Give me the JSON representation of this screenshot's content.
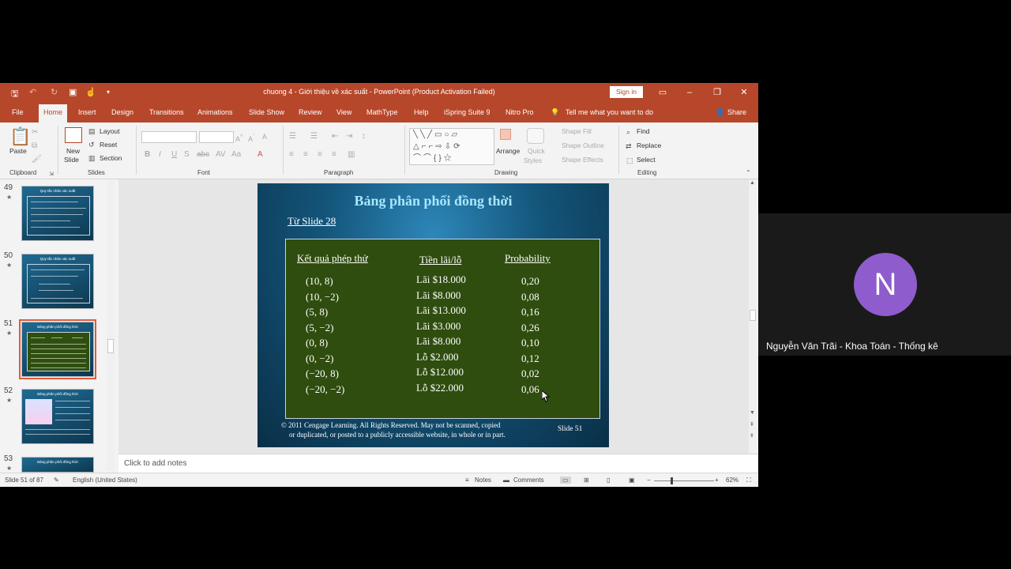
{
  "window": {
    "title": "chuong 4 - Giới thiệu về xác suất  -  PowerPoint (Product Activation Failed)",
    "sign_in": "Sign in",
    "share": "Share",
    "tell_me": "Tell me what you want to do"
  },
  "tabs": [
    "File",
    "Home",
    "Insert",
    "Design",
    "Transitions",
    "Animations",
    "Slide Show",
    "Review",
    "View",
    "MathType",
    "Help",
    "iSpring Suite 9",
    "Nitro Pro"
  ],
  "ribbon": {
    "paste": "Paste",
    "new_slide_1": "New",
    "new_slide_2": "Slide",
    "layout": "Layout",
    "reset": "Reset",
    "section": "Section",
    "arrange": "Arrange",
    "quick_styles_1": "Quick",
    "quick_styles_2": "Styles",
    "shape_fill": "Shape Fill",
    "shape_outline": "Shape Outline",
    "shape_effects": "Shape Effects",
    "find": "Find",
    "replace": "Replace",
    "select": "Select",
    "groups": [
      "Clipboard",
      "Slides",
      "Font",
      "Paragraph",
      "Drawing",
      "Editing"
    ]
  },
  "thumbnails": [
    {
      "num": "49",
      "title": "Quy tắc nhân xác suất"
    },
    {
      "num": "50",
      "title": "Quy tắc nhân xác suất"
    },
    {
      "num": "51",
      "title": "Bảng phân phối đồng thời",
      "selected": true
    },
    {
      "num": "52",
      "title": "Bảng phân phối đồng thời"
    },
    {
      "num": "53",
      "title": "Bảng phân phối đồng thời"
    }
  ],
  "slide": {
    "title": "Bảng phân phối đồng thời",
    "subtitle": "Từ Slide 28",
    "headers": [
      "Kết quả phép thử",
      "Tiền lãi/lỗ",
      "Probability"
    ],
    "rows": [
      [
        "(10,  8)",
        "Lãi $18.000",
        "0,20"
      ],
      [
        "(10, −2)",
        "Lãi  $8.000",
        "0,08"
      ],
      [
        "(5,  8)",
        "Lãi $13.000",
        "0,16"
      ],
      [
        "(5, −2)",
        "Lãi $3.000",
        "0,26"
      ],
      [
        "(0,  8)",
        "Lãi  $8.000",
        "0,10"
      ],
      [
        "(0, −2)",
        "Lỗ  $2.000",
        "0,12"
      ],
      [
        "(−20,  8)",
        "Lỗ $12.000",
        "0,02"
      ],
      [
        "(−20, −2)",
        "Lỗ $22.000",
        "0,06"
      ]
    ],
    "footer_1": "© 2011  Cengage Learning.  All Rights Reserved.  May not be scanned, copied",
    "footer_2": "or duplicated, or posted to a publicly accessible website, in whole or in part.",
    "slide_number": "Slide  51"
  },
  "notes_placeholder": "Click to add notes",
  "status": {
    "slide_count": "Slide 51 of 87",
    "language": "English (United States)",
    "notes": "Notes",
    "comments": "Comments",
    "zoom": "62%"
  },
  "participant": {
    "initial": "N",
    "name": "Nguyễn Văn Trãi - Khoa Toán - Thống kê",
    "avatar_color": "#8e5ccc"
  }
}
